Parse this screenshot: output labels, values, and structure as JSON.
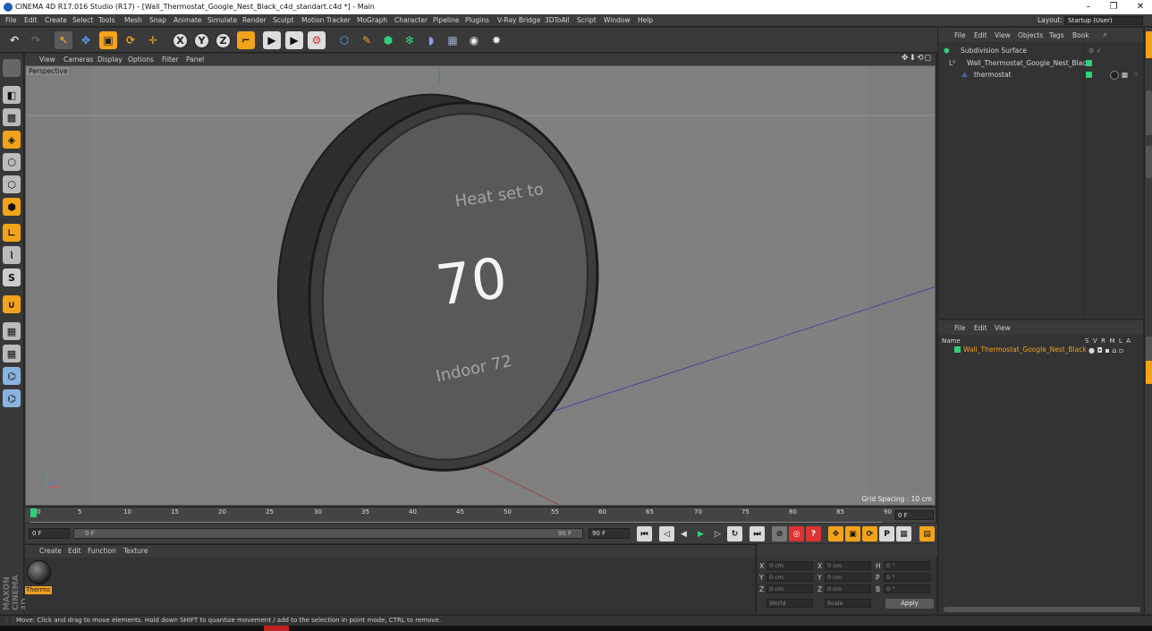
{
  "window": {
    "title": "CINEMA 4D R17.016 Studio (R17) - [Wall_Thermostat_Google_Nest_Black_c4d_standart.c4d *] - Main",
    "minimize": "–",
    "restore": "❐",
    "close": "✕"
  },
  "menubar": {
    "items": [
      "File",
      "Edit",
      "Create",
      "Select",
      "Tools",
      "Mesh",
      "Snap",
      "Animate",
      "Simulate",
      "Render",
      "Sculpt",
      "Motion Tracker",
      "MoGraph",
      "Character",
      "Pipeline",
      "Plugins",
      "V-Ray Bridge",
      "3DToAll",
      "Script",
      "Window",
      "Help"
    ],
    "layout_label": "Layout:",
    "layout_value": "Startup (User)"
  },
  "toolbar": {
    "axis_x": "X",
    "axis_y": "Y",
    "axis_z": "Z"
  },
  "viewport": {
    "menu": [
      "View",
      "Cameras",
      "Display",
      "Options",
      "Filter",
      "Panel"
    ],
    "nav_icons": "✥⬇⟲◻",
    "camera_label": "Perspective",
    "grid_spacing": "Grid Spacing : 10 cm",
    "screen_text_top": "Heat set to",
    "screen_number": "70",
    "screen_text_bottom": "Indoor 72"
  },
  "timeline": {
    "ticks": [
      "0",
      "5",
      "10",
      "15",
      "20",
      "25",
      "30",
      "35",
      "40",
      "45",
      "50",
      "55",
      "60",
      "65",
      "70",
      "75",
      "80",
      "85",
      "90"
    ],
    "current_frame": "0 F"
  },
  "transport": {
    "start_field": "0 F",
    "range_start": "0 F",
    "range_end": "90 F",
    "end_field": "90 F"
  },
  "material_manager": {
    "menu": [
      "Create",
      "Edit",
      "Function",
      "Texture"
    ],
    "material_name": "Thermo"
  },
  "coordinates": {
    "rows": [
      {
        "label": "X",
        "pos": "0 cm",
        "label2": "X",
        "size": "0 cm",
        "label3": "H",
        "rot": "0 °"
      },
      {
        "label": "Y",
        "pos": "0 cm",
        "label2": "Y",
        "size": "0 cm",
        "label3": "P",
        "rot": "0 °"
      },
      {
        "label": "Z",
        "pos": "0 cm",
        "label2": "Z",
        "size": "0 cm",
        "label3": "B",
        "rot": "0 °"
      }
    ],
    "mode_world": "World",
    "mode_scale": "Scale",
    "apply": "Apply"
  },
  "object_manager": {
    "menu": [
      "File",
      "Edit",
      "View",
      "Objects",
      "Tags",
      "Book"
    ],
    "objects": [
      "Subdivision Surface",
      "Wall_Thermostat_Google_Nest_Black",
      "thermostat"
    ]
  },
  "layer_manager": {
    "menu": [
      "File",
      "Edit",
      "View"
    ],
    "header_name": "Name",
    "header_flags": "S  V  R  M  L  A",
    "row": "Wall_Thermostat_Google_Nest_Black"
  },
  "status": {
    "text": "Move: Click and drag to move elements. Hold down SHIFT to quantize movement / add to the selection in point mode, CTRL to remove."
  },
  "branding": "MAXON CINEMA 4D"
}
